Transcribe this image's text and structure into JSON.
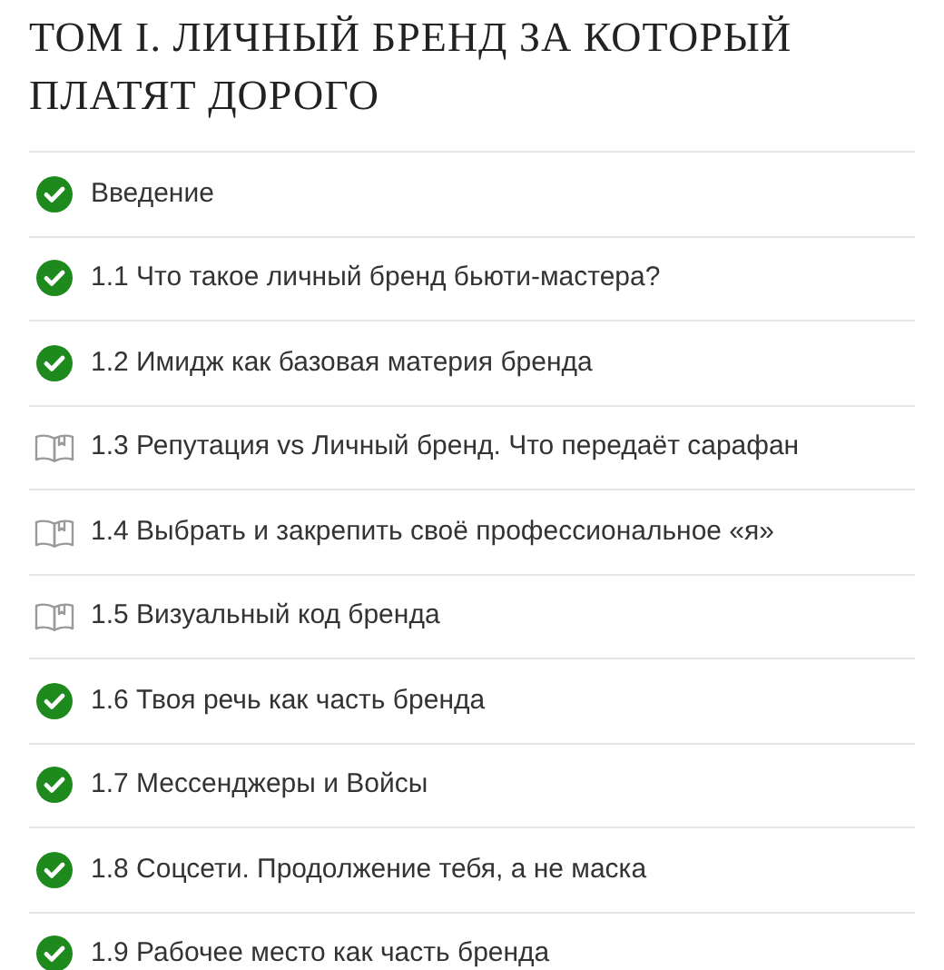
{
  "title": "ТОМ I. ЛИЧНЫЙ БРЕНД ЗА КОТОРЫЙ ПЛАТЯТ ДОРОГО",
  "lessons": [
    {
      "label": "Введение",
      "kind": "done"
    },
    {
      "label": "1.1 Что такое личный бренд бьюти-мастера?",
      "kind": "done"
    },
    {
      "label": "1.2 Имидж как базовая материя бренда",
      "kind": "done"
    },
    {
      "label": "1.3 Репутация vs Личный бренд. Что передаёт сарафан",
      "kind": "open"
    },
    {
      "label": "1.4 Выбрать и закрепить своё профессиональное «я»",
      "kind": "open"
    },
    {
      "label": "1.5 Визуальный код бренда",
      "kind": "open"
    },
    {
      "label": "1.6 Твоя речь как часть бренда",
      "kind": "done"
    },
    {
      "label": "1.7 Мессенджеры и Войсы",
      "kind": "done"
    },
    {
      "label": "1.8 Соцсети. Продолжение тебя, а не маска",
      "kind": "done"
    },
    {
      "label": "1.9 Рабочее место как часть бренда",
      "kind": "done"
    }
  ]
}
